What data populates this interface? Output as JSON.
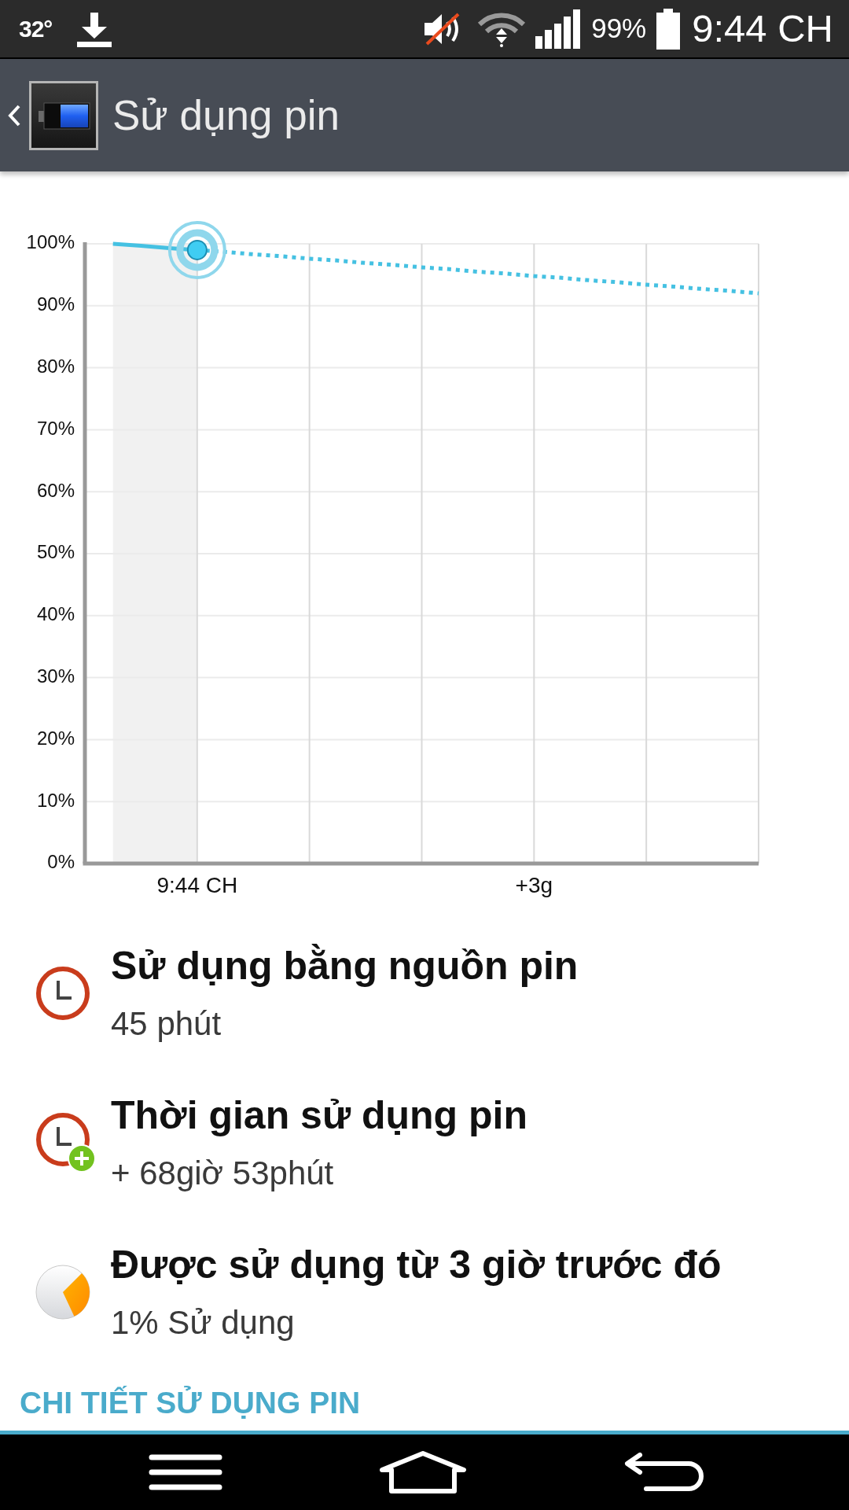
{
  "status_bar": {
    "temperature": "32°",
    "battery_percent": "99%",
    "time": "9:44 CH"
  },
  "app_bar": {
    "title": "Sử dụng pin"
  },
  "chart": {
    "chart_data": {
      "type": "line",
      "grid": true,
      "categories": [
        null,
        null,
        null,
        null,
        "9:44 CH",
        null,
        null,
        null,
        null,
        null,
        null,
        null,
        null,
        null,
        null,
        null,
        "+3g",
        null,
        null,
        null,
        null,
        null,
        null,
        null,
        null
      ],
      "series": [
        {
          "color": "#45c1e2",
          "line_style": "solid",
          "values": [
            null,
            100,
            99.7,
            99.3,
            99,
            null,
            null,
            null,
            null,
            null,
            null,
            null,
            null,
            null,
            null,
            null,
            null,
            null,
            null,
            null,
            null,
            null,
            null,
            null,
            null
          ]
        },
        {
          "color": "#45c1e2",
          "line_style": "dashed",
          "values": [
            null,
            null,
            null,
            null,
            99,
            98.7,
            98.3,
            98,
            97.6,
            97.3,
            96.9,
            96.6,
            96.2,
            95.9,
            95.5,
            95.2,
            94.8,
            94.5,
            94.1,
            93.8,
            93.4,
            93.1,
            92.7,
            92.4,
            92
          ]
        }
      ],
      "ylim": [
        0,
        100
      ],
      "yticks": [
        {
          "value": 0,
          "label": "0%"
        },
        {
          "value": 10,
          "label": "10%"
        },
        {
          "value": 20,
          "label": "20%"
        },
        {
          "value": 30,
          "label": "30%"
        },
        {
          "value": 40,
          "label": "40%"
        },
        {
          "value": 50,
          "label": "50%"
        },
        {
          "value": 60,
          "label": "60%"
        },
        {
          "value": 70,
          "label": "70%"
        },
        {
          "value": 80,
          "label": "80%"
        },
        {
          "value": 90,
          "label": "90%"
        },
        {
          "value": 100,
          "label": "100%"
        }
      ]
    }
  },
  "stats": [
    {
      "kind": "clock",
      "title": "Sử dụng bằng nguồn pin",
      "value": "45 phút"
    },
    {
      "kind": "clock-plus",
      "title": "Thời gian sử dụng pin",
      "value": "+ 68giờ 53phút"
    },
    {
      "kind": "pie",
      "title": "Được sử dụng từ 3 giờ trước đó",
      "value": "1% Sử dụng"
    }
  ],
  "details_header": "CHI TIẾT SỬ DỤNG PIN"
}
